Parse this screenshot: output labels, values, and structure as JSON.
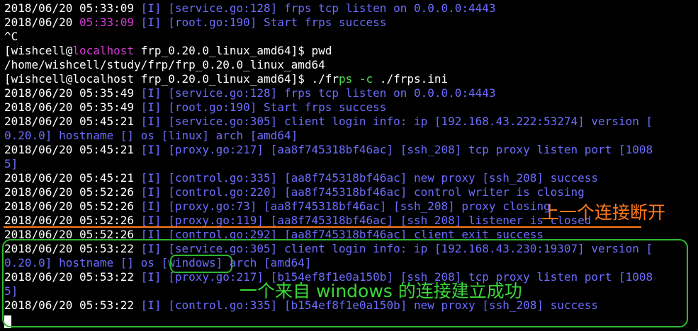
{
  "terminal": {
    "lines": [
      [
        {
          "t": "2018/06/20 05:33:09 ",
          "c": "w"
        },
        {
          "t": "[I] [service.go:128] frps tcp listen on 0.0.0.0:4443",
          "c": "b"
        }
      ],
      [
        {
          "t": "2018/06/20 ",
          "c": "w"
        },
        {
          "t": "05:33:09",
          "c": "m"
        },
        {
          "t": " [I] [root.go:190] Start frps success",
          "c": "b"
        }
      ],
      [
        {
          "t": "^C",
          "c": "w"
        }
      ],
      [
        {
          "t": "[wishcell@",
          "c": "w"
        },
        {
          "t": "localhost",
          "c": "m"
        },
        {
          "t": " frp_0.20.0_linux_amd64]$ pwd",
          "c": "w"
        }
      ],
      [
        {
          "t": "/home/wishcell/study/frp/frp_0.20.0_linux_amd64",
          "c": "w"
        }
      ],
      [
        {
          "t": "[wishcell@localhost frp_0.20.0_linux_amd64]$ ./fr",
          "c": "w"
        },
        {
          "t": "ps -c",
          "c": "g"
        },
        {
          "t": " ./frps.ini",
          "c": "w"
        }
      ],
      [
        {
          "t": "2018/06/20 05:35:49 ",
          "c": "w"
        },
        {
          "t": "[I] [service.go:128] frps tcp listen on 0.0.0.0:4443",
          "c": "b"
        }
      ],
      [
        {
          "t": "2018/06/20 05:35:49 ",
          "c": "w"
        },
        {
          "t": "[I] [root.go:190] Start frps success",
          "c": "b"
        }
      ],
      [
        {
          "t": "2018/06/20 05:45:21 ",
          "c": "w"
        },
        {
          "t": "[I] [service.go:305] client login info: ip [192.168.43.222:53274] version [",
          "c": "b"
        }
      ],
      [
        {
          "t": "0.20.0] hostname [] os [linux] arch [amd64]",
          "c": "b"
        }
      ],
      [
        {
          "t": "2018/06/20 05:45:21 ",
          "c": "w"
        },
        {
          "t": "[I] [proxy.go:217] [aa8f745318bf46ac] [ssh_208] tcp proxy listen port [1008",
          "c": "b"
        }
      ],
      [
        {
          "t": "5]",
          "c": "b"
        }
      ],
      [
        {
          "t": "2018/06/20 05:45:21 ",
          "c": "w"
        },
        {
          "t": "[I] [control.go:335] [aa8f745318bf46ac] new proxy [ssh_208] success",
          "c": "b"
        }
      ],
      [
        {
          "t": "2018/06/20 05:52:26 ",
          "c": "w"
        },
        {
          "t": "[I] [control.go:220] [aa8f745318bf46ac] control writer is closing",
          "c": "b"
        }
      ],
      [
        {
          "t": "2018/06/20 05:52:26 ",
          "c": "w"
        },
        {
          "t": "[I] [proxy.go:73] [aa8f745318bf46ac] [ssh_208] proxy closing",
          "c": "b"
        }
      ],
      [
        {
          "t": "2018/06/20 05:52:26 ",
          "c": "w"
        },
        {
          "t": "[I] [proxy.go:119] [aa8f745318bf46ac] [ssh_208] listener is closed",
          "c": "b"
        }
      ],
      [
        {
          "t": "2018/06/20 05:52:26 ",
          "c": "w"
        },
        {
          "t": "[I] [control.go:292] [aa8f745318bf46ac] client exit success",
          "c": "b"
        }
      ],
      [
        {
          "t": "2018/06/20 05:53:22 ",
          "c": "w"
        },
        {
          "t": "[I] [service.go:305] client login info: ip [192.168.43.230:19307] version [",
          "c": "b"
        }
      ],
      [
        {
          "t": "0.20.0] hostname [] os [windows] arch [amd64]",
          "c": "b"
        }
      ],
      [
        {
          "t": "2018/06/20 05:53:22 ",
          "c": "w"
        },
        {
          "t": "[I] [proxy.go:217] [b154ef8f1e0a150b] [ssh_208] tcp proxy listen port [1008",
          "c": "b"
        }
      ],
      [
        {
          "t": "5]",
          "c": "b"
        }
      ],
      [
        {
          "t": "2018/06/20 05:53:22 ",
          "c": "w"
        },
        {
          "t": "[I] [control.go:335] [b154ef8f1e0a150b] new proxy [ssh_208] success",
          "c": "b"
        }
      ]
    ]
  },
  "annotations": {
    "disconnect_label": "上一个连接断开",
    "success_label": "一个来自 windows 的连接建立成功"
  },
  "colors": {
    "background": "#000000",
    "text": "#ffffff",
    "log": "#6c6cff",
    "highlight": "#d23cd2",
    "annotation_orange": "#ff7a1a",
    "annotation_green": "#2eb82e"
  }
}
